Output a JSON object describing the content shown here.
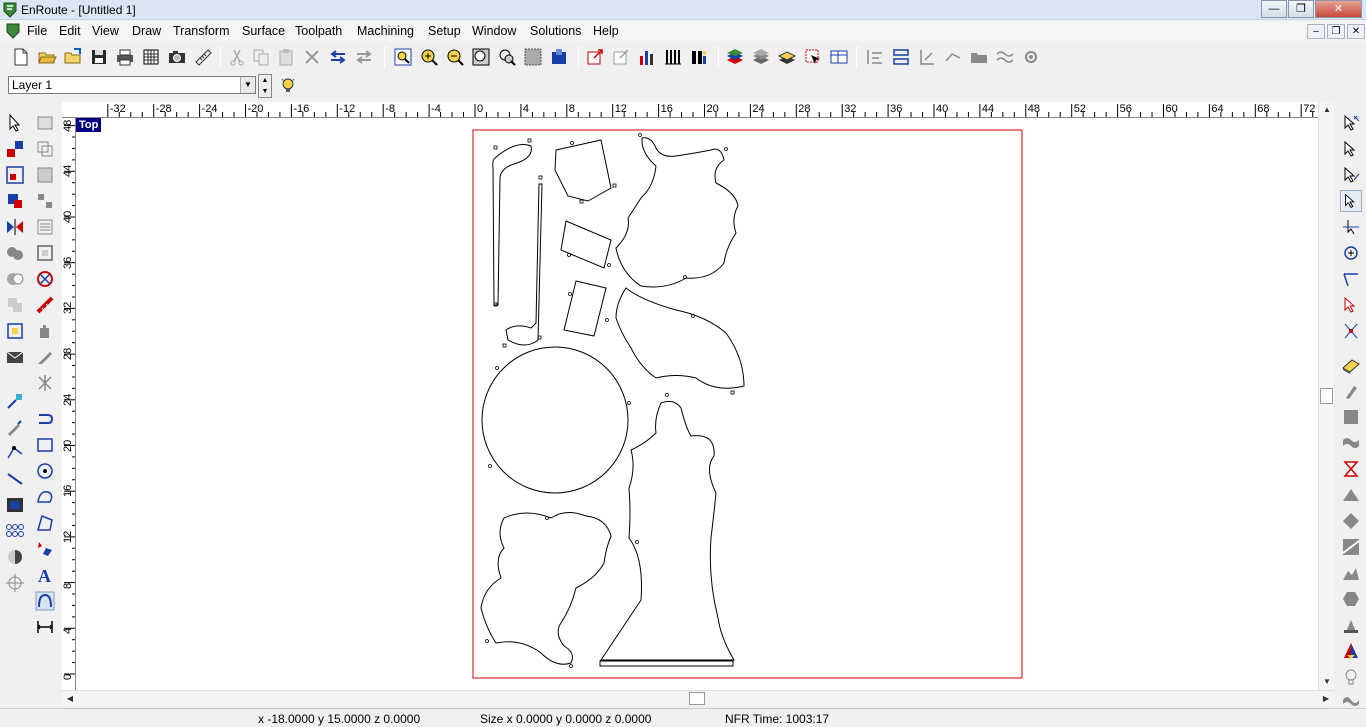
{
  "window": {
    "title": "EnRoute - [Untitled 1]"
  },
  "menu": {
    "items": [
      "File",
      "Edit",
      "View",
      "Draw",
      "Transform",
      "Surface",
      "Toolpath",
      "Machining",
      "Setup",
      "Window",
      "Solutions",
      "Help"
    ]
  },
  "layer": {
    "current": "Layer 1"
  },
  "viewport": {
    "label": "Top"
  },
  "ruler": {
    "top_ticks": [
      "-32",
      "-28",
      "-24",
      "-20",
      "-16",
      "-12",
      "-8",
      "-4",
      "0",
      "4",
      "8",
      "12",
      "16",
      "20",
      "24",
      "28",
      "32",
      "36",
      "40",
      "44",
      "48",
      "52",
      "56",
      "60",
      "64",
      "68",
      "72"
    ],
    "left_ticks": [
      "48",
      "44",
      "40",
      "36",
      "32",
      "28",
      "24",
      "20",
      "16",
      "12",
      "8",
      "4",
      "0"
    ]
  },
  "status": {
    "coords": "x -18.0000 y 15.0000 z 0.0000",
    "size": "Size x 0.0000 y 0.0000 z 0.0000",
    "nfr": "NFR Time: 1003:17"
  },
  "colors": {
    "sheet_border": "#cc0000",
    "accent": "#000080",
    "canvas": "#ffffff"
  }
}
